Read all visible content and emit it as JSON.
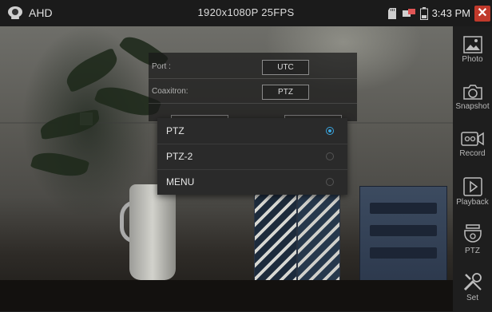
{
  "status_bar": {
    "mode": "AHD",
    "resolution": "1920x1080P 25FPS",
    "time": "3:43 PM",
    "close_label": "✕"
  },
  "toolbar": {
    "items": [
      {
        "label": "Photo",
        "icon": "photo-icon"
      },
      {
        "label": "Snapshot",
        "icon": "camera-icon"
      },
      {
        "label": "Record",
        "icon": "record-icon"
      },
      {
        "label": "Playback",
        "icon": "play-icon"
      },
      {
        "label": "PTZ",
        "icon": "ptz-dome-icon"
      },
      {
        "label": "Set",
        "icon": "tools-icon"
      }
    ]
  },
  "settings": {
    "port_label": "Port :",
    "port_value": "UTC",
    "coaxitron_label": "Coaxitron:",
    "coaxitron_value": "PTZ"
  },
  "dropdown": {
    "options": [
      {
        "label": "PTZ",
        "selected": true
      },
      {
        "label": "PTZ-2",
        "selected": false
      },
      {
        "label": "MENU",
        "selected": false
      }
    ]
  },
  "colors": {
    "accent": "#3aa6e0",
    "close": "#c0392b",
    "arrow": "#2d6a3a"
  }
}
